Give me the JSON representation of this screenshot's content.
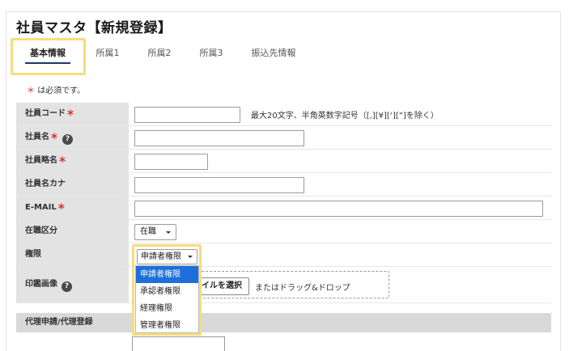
{
  "page": {
    "title": "社員マスタ【新規登録】"
  },
  "tabs": [
    {
      "label": "基本情報",
      "active": true
    },
    {
      "label": "所属1",
      "active": false
    },
    {
      "label": "所属2",
      "active": false
    },
    {
      "label": "所属3",
      "active": false
    },
    {
      "label": "振込先情報",
      "active": false
    }
  ],
  "required_note": {
    "star": "＊",
    "text": "は必須です。"
  },
  "fields": {
    "employee_code": {
      "label": "社員コード",
      "required_mark": "＊",
      "value": "",
      "hint": "最大20文字、半角英数字記号（[,][¥][‘][”]を除く）"
    },
    "employee_name": {
      "label": "社員名",
      "required_mark": "＊",
      "help_icon": "?",
      "value": ""
    },
    "employee_short_name": {
      "label": "社員略名",
      "required_mark": "＊",
      "value": ""
    },
    "employee_kana": {
      "label": "社員名カナ",
      "value": ""
    },
    "email": {
      "label": "E-MAIL",
      "required_mark": "＊",
      "value": ""
    },
    "employment_status": {
      "label": "在職区分",
      "selected": "在職"
    },
    "authority": {
      "label": "権限",
      "selected": "申請者権限",
      "options": [
        "申請者権限",
        "承認者権限",
        "経理権限",
        "管理者権限"
      ]
    },
    "seal_image": {
      "label": "印鑑画像",
      "help_icon": "?",
      "file_button": "ァイルを選択",
      "drop_text": "またはドラッグ&ドロップ"
    }
  },
  "sections": {
    "proxy": "代理申請/代理登録"
  },
  "colors": {
    "accent": "#1e6fd9",
    "highlight": "#f7dc7c",
    "required": "#e02020",
    "label_bg": "#e3e3e3"
  }
}
